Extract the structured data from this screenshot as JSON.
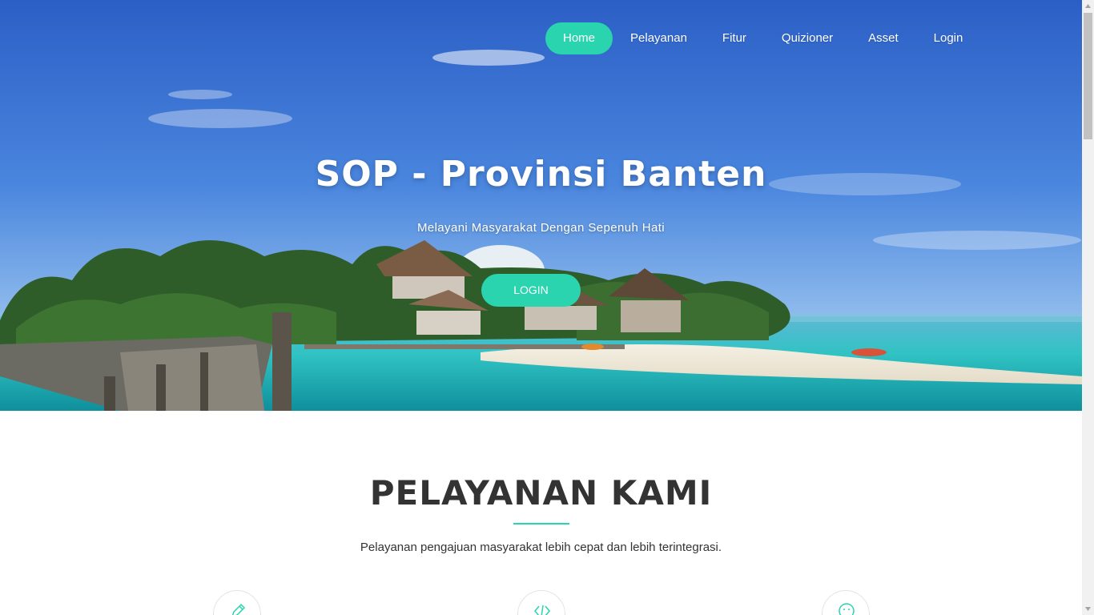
{
  "nav": {
    "items": [
      {
        "label": "Home",
        "active": true
      },
      {
        "label": "Pelayanan",
        "active": false
      },
      {
        "label": "Fitur",
        "active": false
      },
      {
        "label": "Quizioner",
        "active": false
      },
      {
        "label": "Asset",
        "active": false
      },
      {
        "label": "Login",
        "active": false
      }
    ]
  },
  "hero": {
    "title": "SOP - Provinsi Banten",
    "subtitle": "Melayani Masyarakat Dengan Sepenuh Hati",
    "button_label": "LOGIN",
    "background": "beach-island-pier-photo"
  },
  "services": {
    "title": "PELAYANAN KAMI",
    "description": "Pelayanan pengajuan masyarakat lebih cepat dan lebih terintegrasi.",
    "icons": [
      "pencil-icon",
      "code-icon",
      "smiley-icon"
    ]
  },
  "colors": {
    "accent": "#29d4ae",
    "text": "#333333",
    "sky_top": "#2f64c9",
    "sea": "#2ec7c2"
  }
}
